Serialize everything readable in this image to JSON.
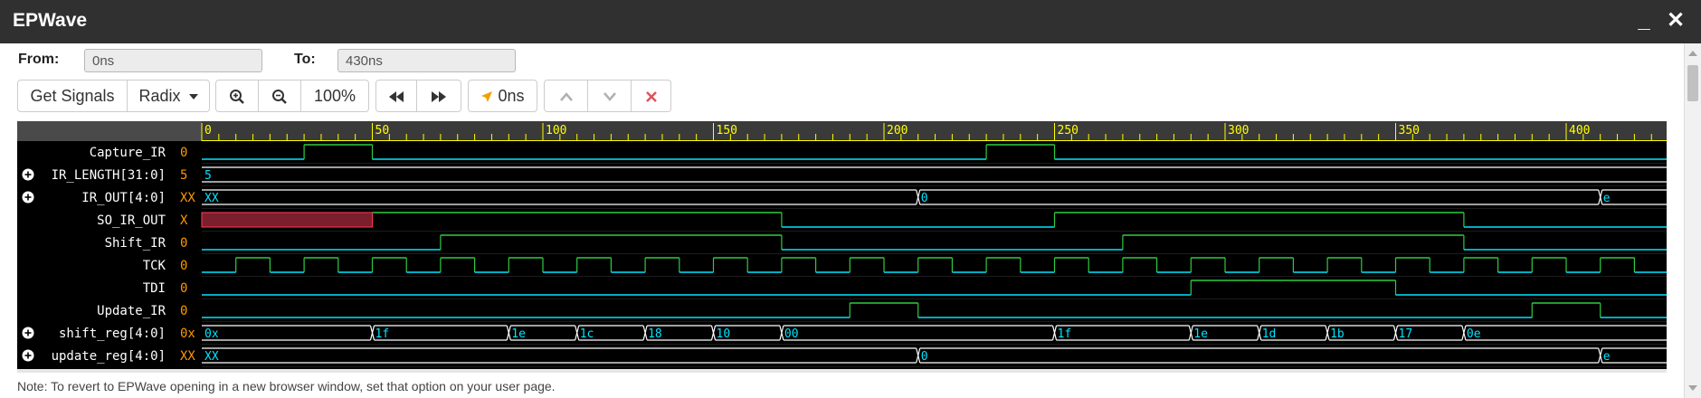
{
  "app": {
    "title": "EPWave",
    "minimize_label": "_",
    "close_label": "✕"
  },
  "range": {
    "from_label": "From:",
    "from_value": "0ns",
    "to_label": "To:",
    "to_value": "430ns"
  },
  "toolbar": {
    "get_signals": "Get Signals",
    "radix": "Radix",
    "zoom_level": "100%",
    "cursor_time": "0ns",
    "icons": [
      "zoom-in-icon",
      "zoom-out-icon",
      "rewind-icon",
      "fast-forward-icon",
      "cursor-arrow-icon",
      "chevron-up-icon",
      "chevron-down-icon",
      "remove-icon"
    ],
    "remove_color": "#e0525a"
  },
  "timeline": {
    "ticks": [
      "0",
      "50",
      "100",
      "150",
      "200",
      "250",
      "300",
      "350",
      "400"
    ],
    "unit_ns_per_major": 50
  },
  "signals": [
    {
      "name": "Capture_IR",
      "value": "0",
      "expandable": false,
      "type": "bit",
      "segments": [
        [
          0,
          30,
          0
        ],
        [
          30,
          50,
          1
        ],
        [
          50,
          230,
          0
        ],
        [
          230,
          250,
          1
        ],
        [
          250,
          430,
          0
        ]
      ]
    },
    {
      "name": "IR_LENGTH[31:0]",
      "value": "5",
      "expandable": true,
      "type": "bus",
      "labels": [
        [
          0,
          "5"
        ]
      ]
    },
    {
      "name": "IR_OUT[4:0]",
      "value": "XX",
      "expandable": true,
      "type": "bus",
      "labels": [
        [
          0,
          "XX"
        ],
        [
          210,
          "0"
        ],
        [
          410,
          "e"
        ]
      ]
    },
    {
      "name": "SO_IR_OUT",
      "value": "X",
      "expandable": false,
      "type": "bit",
      "x_range": [
        0,
        50
      ],
      "segments": [
        [
          50,
          170,
          1
        ],
        [
          170,
          250,
          0
        ],
        [
          250,
          370,
          1
        ],
        [
          370,
          430,
          0
        ]
      ]
    },
    {
      "name": "Shift_IR",
      "value": "0",
      "expandable": false,
      "type": "bit",
      "segments": [
        [
          0,
          70,
          0
        ],
        [
          70,
          170,
          1
        ],
        [
          170,
          270,
          0
        ],
        [
          270,
          370,
          1
        ],
        [
          370,
          430,
          0
        ]
      ]
    },
    {
      "name": "TCK",
      "value": "0",
      "expandable": false,
      "type": "clock",
      "period": 20,
      "first_rise": 10
    },
    {
      "name": "TDI",
      "value": "0",
      "expandable": false,
      "type": "bit",
      "segments": [
        [
          0,
          290,
          0
        ],
        [
          290,
          350,
          1
        ],
        [
          350,
          430,
          0
        ]
      ]
    },
    {
      "name": "Update_IR",
      "value": "0",
      "expandable": false,
      "type": "bit",
      "segments": [
        [
          0,
          190,
          0
        ],
        [
          190,
          210,
          1
        ],
        [
          210,
          390,
          0
        ],
        [
          390,
          410,
          1
        ],
        [
          410,
          430,
          0
        ]
      ]
    },
    {
      "name": "shift_reg[4:0]",
      "value": "0x",
      "expandable": true,
      "type": "bus",
      "labels": [
        [
          0,
          "0x"
        ],
        [
          50,
          "1f"
        ],
        [
          90,
          "1e"
        ],
        [
          110,
          "1c"
        ],
        [
          130,
          "18"
        ],
        [
          150,
          "10"
        ],
        [
          170,
          "00"
        ],
        [
          250,
          "1f"
        ],
        [
          290,
          "1e"
        ],
        [
          310,
          "1d"
        ],
        [
          330,
          "1b"
        ],
        [
          350,
          "17"
        ],
        [
          370,
          "0e"
        ]
      ]
    },
    {
      "name": "update_reg[4:0]",
      "value": "XX",
      "expandable": true,
      "type": "bus",
      "labels": [
        [
          0,
          "XX"
        ],
        [
          210,
          "0"
        ],
        [
          410,
          "e"
        ]
      ]
    }
  ],
  "colors": {
    "high": "#2ecc40",
    "low": "#00e5ff",
    "bus_text": "#00e5ff",
    "bus_line": "#ffffff",
    "value_text": "#ff9900",
    "x_fill": "#7a1f2b",
    "ruler_bg": "#4a4a4a",
    "ruler_text": "#ffff00"
  },
  "note": "Note: To revert to EPWave opening in a new browser window, set that option on your user page."
}
